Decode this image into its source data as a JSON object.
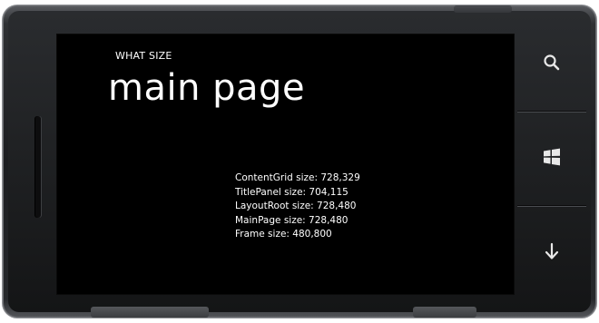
{
  "app": {
    "title": "WHAT SIZE",
    "page_title": "main page"
  },
  "content": {
    "lines": [
      "ContentGrid size: 728,329",
      "TitlePanel size: 704,115",
      "LayoutRoot size: 728,480",
      "MainPage size: 728,480",
      "Frame size: 480,800"
    ]
  },
  "hardware_buttons": {
    "search_icon": "search-icon",
    "start_icon": "windows-logo-icon",
    "back_icon": "back-arrow-icon"
  },
  "colors": {
    "screen_background": "#000000",
    "text": "#ffffff",
    "bezel": "#1c1d20"
  }
}
